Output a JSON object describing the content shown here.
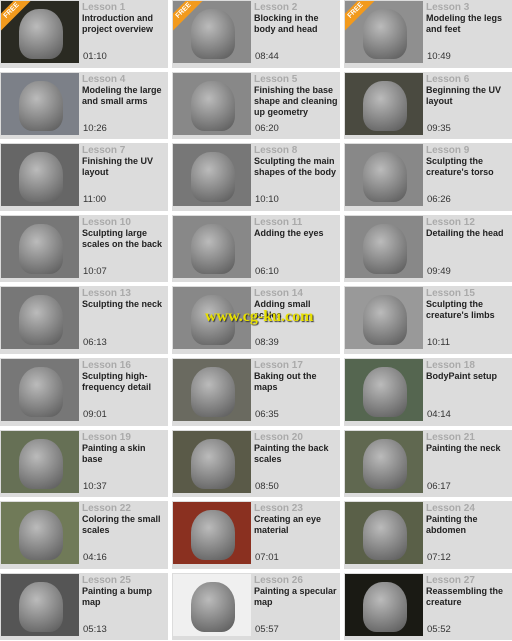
{
  "lessons": [
    {
      "num": "Lesson 1",
      "title": "Introduction and project overview",
      "dur": "01:10",
      "free": "FREE",
      "thumb": "#2a2a22"
    },
    {
      "num": "Lesson 2",
      "title": "Blocking in the body and head",
      "dur": "08:44",
      "free": "FREE",
      "thumb": "#8a8a8a"
    },
    {
      "num": "Lesson 3",
      "title": "Modeling the legs and feet",
      "dur": "10:49",
      "free": "FREE",
      "thumb": "#8f8f8f"
    },
    {
      "num": "Lesson 4",
      "title": "Modeling the large and small arms",
      "dur": "10:26",
      "thumb": "#7c8088"
    },
    {
      "num": "Lesson 5",
      "title": "Finishing the base shape and cleaning up geometry",
      "dur": "06:20",
      "thumb": "#888"
    },
    {
      "num": "Lesson 6",
      "title": "Beginning the UV layout",
      "dur": "09:35",
      "thumb": "#4a4a40"
    },
    {
      "num": "Lesson 7",
      "title": "Finishing the UV layout",
      "dur": "11:00",
      "thumb": "#666"
    },
    {
      "num": "Lesson 8",
      "title": "Sculpting the main shapes of the body",
      "dur": "10:10",
      "thumb": "#777"
    },
    {
      "num": "Lesson 9",
      "title": "Sculpting the creature's torso",
      "dur": "06:26",
      "thumb": "#888"
    },
    {
      "num": "Lesson 10",
      "title": "Sculpting large scales on the back",
      "dur": "10:07",
      "thumb": "#777"
    },
    {
      "num": "Lesson 11",
      "title": "Adding the eyes",
      "dur": "06:10",
      "thumb": "#888"
    },
    {
      "num": "Lesson 12",
      "title": "Detailing the head",
      "dur": "09:49",
      "thumb": "#888"
    },
    {
      "num": "Lesson 13",
      "title": "Sculpting the neck",
      "dur": "06:13",
      "thumb": "#777"
    },
    {
      "num": "Lesson 14",
      "title": "Adding small scales",
      "dur": "08:39",
      "thumb": "#888"
    },
    {
      "num": "Lesson 15",
      "title": "Sculpting the creature's limbs",
      "dur": "10:11",
      "thumb": "#999"
    },
    {
      "num": "Lesson 16",
      "title": "Sculpting high-frequency detail",
      "dur": "09:01",
      "thumb": "#777"
    },
    {
      "num": "Lesson 17",
      "title": "Baking out the maps",
      "dur": "06:35",
      "thumb": "#6a6a60"
    },
    {
      "num": "Lesson 18",
      "title": "BodyPaint setup",
      "dur": "04:14",
      "thumb": "#556650"
    },
    {
      "num": "Lesson 19",
      "title": "Painting a skin base",
      "dur": "10:37",
      "thumb": "#667055"
    },
    {
      "num": "Lesson 20",
      "title": "Painting the back scales",
      "dur": "08:50",
      "thumb": "#5a5a48"
    },
    {
      "num": "Lesson 21",
      "title": "Painting the neck",
      "dur": "06:17",
      "thumb": "#606850"
    },
    {
      "num": "Lesson 22",
      "title": "Coloring the small scales",
      "dur": "04:16",
      "thumb": "#707a58"
    },
    {
      "num": "Lesson 23",
      "title": "Creating an eye material",
      "dur": "07:01",
      "thumb": "#8a3020"
    },
    {
      "num": "Lesson 24",
      "title": "Painting the abdomen",
      "dur": "07:12",
      "thumb": "#5a6048"
    },
    {
      "num": "Lesson 25",
      "title": "Painting a bump map",
      "dur": "05:13",
      "thumb": "#555"
    },
    {
      "num": "Lesson 26",
      "title": "Painting a specular map",
      "dur": "05:57",
      "thumb": "#f0f0f0"
    },
    {
      "num": "Lesson 27",
      "title": "Reassembling the creature",
      "dur": "05:52",
      "thumb": "#1a1a14"
    }
  ],
  "watermark": "www.cg-ku.com"
}
